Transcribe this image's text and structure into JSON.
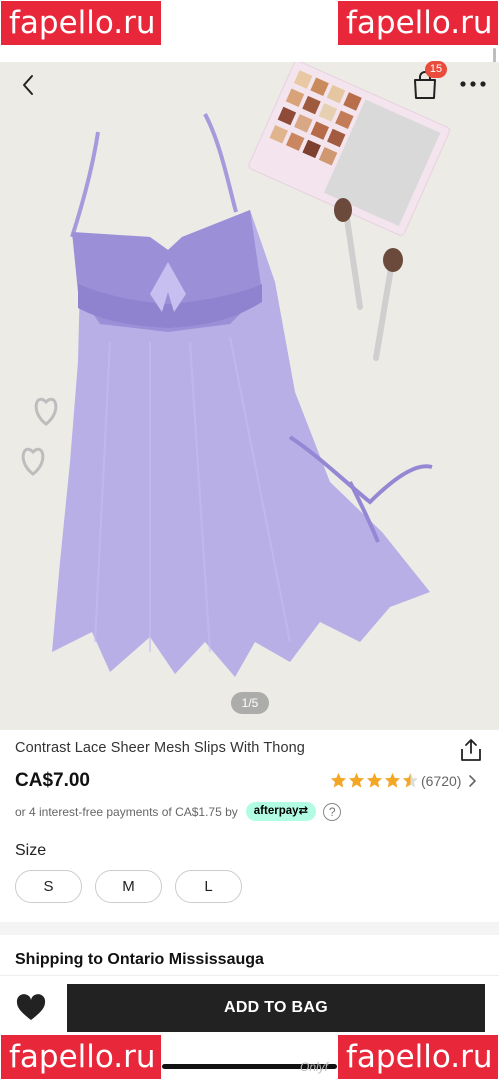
{
  "watermark": {
    "text": "fapello.ru"
  },
  "header": {
    "cart_count": "15"
  },
  "gallery": {
    "pager": "1/5"
  },
  "product": {
    "title": "Contrast Lace Sheer Mesh Slips With Thong",
    "price": "CA$7.00",
    "rating": 4.5,
    "rating_count": "(6720)",
    "installment_text": "or 4 interest-free payments of CA$1.75 by",
    "afterpay_label": "afterpay⇄"
  },
  "size": {
    "label": "Size",
    "options": [
      "S",
      "M",
      "L"
    ]
  },
  "shipping": {
    "text": "Shipping to Ontario Mississauga"
  },
  "actions": {
    "add_to_bag": "ADD TO BAG"
  },
  "footer_mark": "Onlyf",
  "colors": {
    "accent": "#222222",
    "badge": "#e94b3c",
    "star": "#f5a623",
    "afterpay": "#b2fce4",
    "product": "#9b8fd8"
  }
}
